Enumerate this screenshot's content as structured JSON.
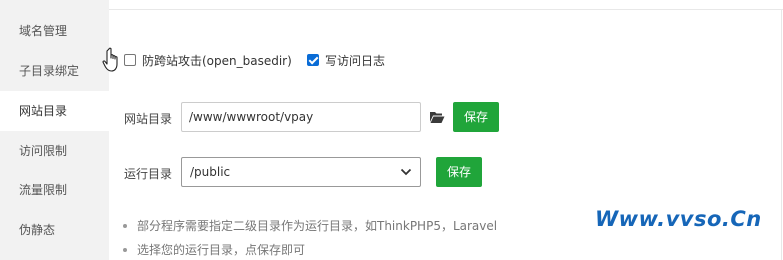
{
  "sidebar": {
    "items": [
      {
        "label": "域名管理"
      },
      {
        "label": "子目录绑定"
      },
      {
        "label": "网站目录"
      },
      {
        "label": "访问限制"
      },
      {
        "label": "流量限制"
      },
      {
        "label": "伪静态"
      }
    ],
    "active_index": 2
  },
  "options": {
    "anti_cross_site": {
      "label": "防跨站攻击(open_basedir)",
      "checked": false
    },
    "access_log": {
      "label": "写访问日志",
      "checked": true
    }
  },
  "site_dir": {
    "label": "网站目录",
    "value": "/www/wwwroot/vpay",
    "folder_icon": "folder-open-icon",
    "save_label": "保存"
  },
  "run_dir": {
    "label": "运行目录",
    "selected": "/public",
    "save_label": "保存"
  },
  "tips": [
    "部分程序需要指定二级目录作为运行目录，如ThinkPHP5，Laravel",
    "选择您的运行目录，点保存即可"
  ],
  "watermark": "Www.vvso.Cn",
  "colors": {
    "accent_green": "#20a53a",
    "sidebar_bg": "#f2f2f2",
    "checkbox_blue": "#0a6cd6",
    "watermark_blue": "#1666b8"
  }
}
